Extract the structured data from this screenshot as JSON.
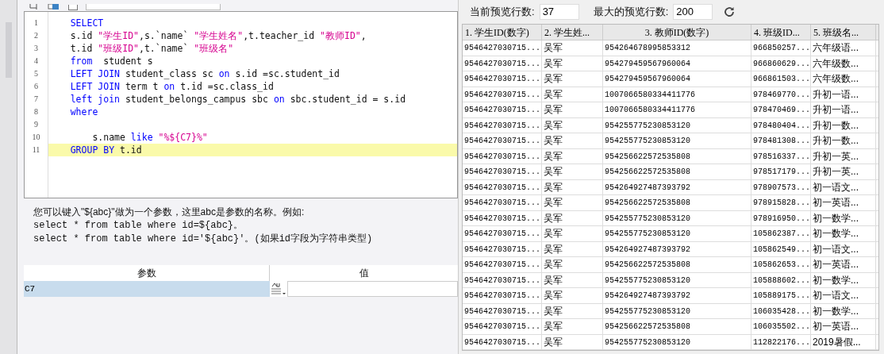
{
  "toolbar": {
    "shared_dataset_checked": false
  },
  "editor": {
    "lines": [
      {
        "number": "1",
        "highlighted": false,
        "tokens": [
          {
            "kind": "keyword",
            "text": "    SELECT"
          }
        ]
      },
      {
        "number": "2",
        "highlighted": false,
        "tokens": [
          {
            "kind": "plain",
            "text": "    s.id "
          },
          {
            "kind": "string",
            "text": "\"学生ID\""
          },
          {
            "kind": "plain",
            "text": ",s.`name` "
          },
          {
            "kind": "string",
            "text": "\"学生姓名\""
          },
          {
            "kind": "plain",
            "text": ",t.teacher_id "
          },
          {
            "kind": "string",
            "text": "\"教师ID\""
          },
          {
            "kind": "plain",
            "text": ","
          }
        ]
      },
      {
        "number": "3",
        "highlighted": false,
        "tokens": [
          {
            "kind": "plain",
            "text": "    t.id "
          },
          {
            "kind": "string",
            "text": "\"班级ID\""
          },
          {
            "kind": "plain",
            "text": ",t.`name` "
          },
          {
            "kind": "string",
            "text": "\"班级名\""
          }
        ]
      },
      {
        "number": "4",
        "highlighted": false,
        "tokens": [
          {
            "kind": "keyword",
            "text": "    from"
          },
          {
            "kind": "plain",
            "text": "  student s"
          }
        ]
      },
      {
        "number": "5",
        "highlighted": false,
        "tokens": [
          {
            "kind": "keyword",
            "text": "    LEFT JOIN"
          },
          {
            "kind": "plain",
            "text": " student_class sc "
          },
          {
            "kind": "keyword",
            "text": "on"
          },
          {
            "kind": "plain",
            "text": " s.id =sc.student_id"
          }
        ]
      },
      {
        "number": "6",
        "highlighted": false,
        "tokens": [
          {
            "kind": "keyword",
            "text": "    LEFT JOIN"
          },
          {
            "kind": "plain",
            "text": " term t "
          },
          {
            "kind": "keyword",
            "text": "on"
          },
          {
            "kind": "plain",
            "text": " t.id =sc.class_id"
          }
        ]
      },
      {
        "number": "7",
        "highlighted": false,
        "tokens": [
          {
            "kind": "keyword",
            "text": "    left join"
          },
          {
            "kind": "plain",
            "text": " student_belongs_campus sbc "
          },
          {
            "kind": "keyword",
            "text": "on"
          },
          {
            "kind": "plain",
            "text": " sbc.student_id = s.id"
          }
        ]
      },
      {
        "number": "8",
        "highlighted": false,
        "tokens": [
          {
            "kind": "keyword",
            "text": "    where"
          }
        ]
      },
      {
        "number": "9",
        "highlighted": false
      },
      {
        "number": "10",
        "highlighted": false,
        "tokens": [
          {
            "kind": "plain",
            "text": "        s.name "
          },
          {
            "kind": "keyword",
            "text": "like "
          },
          {
            "kind": "string",
            "text": "\"%${C7}%\""
          }
        ]
      },
      {
        "number": "11",
        "highlighted": true,
        "tokens": [
          {
            "kind": "keyword",
            "text": "    GROUP BY"
          },
          {
            "kind": "plain",
            "text": " t.id"
          }
        ]
      }
    ]
  },
  "help": [
    "您可以键入\"${abc}\"做为一个参数，这里abc是参数的名称。例如:",
    "select * from table where id=${abc}。",
    "select * from table where id='${abc}'。(如果id字段为字符串类型)"
  ],
  "params": {
    "columns": [
      "参数",
      "值"
    ],
    "rows": [
      {
        "name": "C7",
        "value": "",
        "selected": true
      }
    ]
  },
  "preview": {
    "current_label": "当前预览行数:",
    "current_value": "37",
    "max_label": "最大的预览行数:",
    "max_value": "200"
  },
  "table": {
    "columns": [
      "1. 学生ID(数字)",
      "2. 学生姓...",
      "3. 教师ID(数字)",
      "4. 班级ID...",
      "5. 班级名..."
    ],
    "rows": [
      [
        "9546427030715...",
        "吴军",
        "954264678995853312",
        "966850257...",
        "六年级语..."
      ],
      [
        "9546427030715...",
        "吴军",
        "954279459567960064",
        "966860629...",
        "六年级数..."
      ],
      [
        "9546427030715...",
        "吴军",
        "954279459567960064",
        "966861503...",
        "六年级数..."
      ],
      [
        "9546427030715...",
        "吴军",
        "1007066580334411776",
        "978469770...",
        "升初一语..."
      ],
      [
        "9546427030715...",
        "吴军",
        "1007066580334411776",
        "978470469...",
        "升初一语..."
      ],
      [
        "9546427030715...",
        "吴军",
        "954255775230853120",
        "978480404...",
        "升初一数..."
      ],
      [
        "9546427030715...",
        "吴军",
        "954255775230853120",
        "978481308...",
        "升初一数..."
      ],
      [
        "9546427030715...",
        "吴军",
        "954256622572535808",
        "978516337...",
        "升初一英..."
      ],
      [
        "9546427030715...",
        "吴军",
        "954256622572535808",
        "978517179...",
        "升初一英..."
      ],
      [
        "9546427030715...",
        "吴军",
        "954264927487393792",
        "978907573...",
        "初一语文..."
      ],
      [
        "9546427030715...",
        "吴军",
        "954256622572535808",
        "978915828...",
        "初一英语..."
      ],
      [
        "9546427030715...",
        "吴军",
        "954255775230853120",
        "978916950...",
        "初一数学..."
      ],
      [
        "9546427030715...",
        "吴军",
        "954255775230853120",
        "105862387...",
        "初一数学..."
      ],
      [
        "9546427030715...",
        "吴军",
        "954264927487393792",
        "105862549...",
        "初一语文..."
      ],
      [
        "9546427030715...",
        "吴军",
        "954256622572535808",
        "105862653...",
        "初一英语..."
      ],
      [
        "9546427030715...",
        "吴军",
        "954255775230853120",
        "105888602...",
        "初一数学..."
      ],
      [
        "9546427030715...",
        "吴军",
        "954264927487393792",
        "105889175...",
        "初一语文..."
      ],
      [
        "9546427030715...",
        "吴军",
        "954255775230853120",
        "106035428...",
        "初一数学..."
      ],
      [
        "9546427030715...",
        "吴军",
        "954256622572535808",
        "106035502...",
        "初一英语..."
      ],
      [
        "9546427030715...",
        "吴军",
        "954255775230853120",
        "112822176...",
        "2019暑假..."
      ]
    ]
  }
}
